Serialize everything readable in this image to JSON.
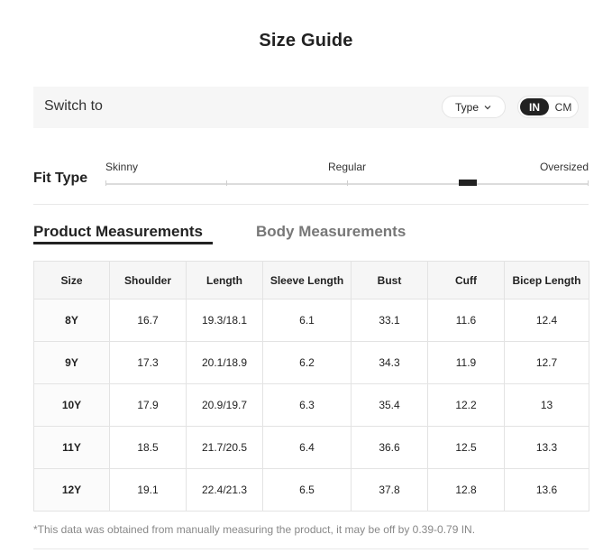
{
  "title": "Size Guide",
  "switch_bar": {
    "label": "Switch to",
    "type_select": "Type",
    "units": {
      "in": "IN",
      "cm": "CM",
      "selected": "IN"
    }
  },
  "fit_type": {
    "label": "Fit Type",
    "options": [
      "Skinny",
      "Regular",
      "Oversized"
    ]
  },
  "tabs": {
    "product": "Product Measurements",
    "body": "Body Measurements",
    "active": "Product Measurements"
  },
  "table": {
    "headers": [
      "Size",
      "Shoulder",
      "Length",
      "Sleeve Length",
      "Bust",
      "Cuff",
      "Bicep Length"
    ],
    "rows": [
      [
        "8Y",
        "16.7",
        "19.3/18.1",
        "6.1",
        "33.1",
        "11.6",
        "12.4"
      ],
      [
        "9Y",
        "17.3",
        "20.1/18.9",
        "6.2",
        "34.3",
        "11.9",
        "12.7"
      ],
      [
        "10Y",
        "17.9",
        "20.9/19.7",
        "6.3",
        "35.4",
        "12.2",
        "13"
      ],
      [
        "11Y",
        "18.5",
        "21.7/20.5",
        "6.4",
        "36.6",
        "12.5",
        "13.3"
      ],
      [
        "12Y",
        "19.1",
        "22.4/21.3",
        "6.5",
        "37.8",
        "12.8",
        "13.6"
      ]
    ]
  },
  "footnote": "*This data was obtained from manually measuring the product, it may be off by 0.39-0.79 IN."
}
